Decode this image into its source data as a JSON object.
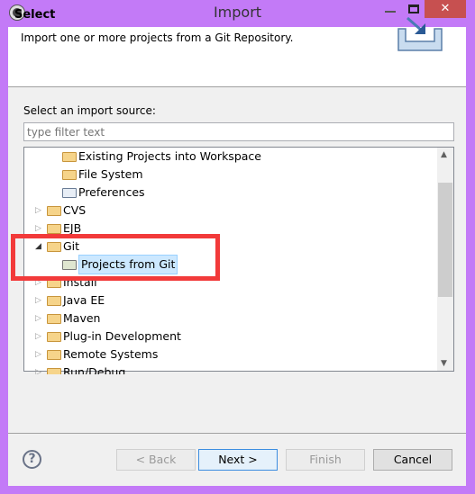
{
  "window": {
    "title": "Import",
    "close_glyph": "✕"
  },
  "header": {
    "title": "Select",
    "description": "Import one or more projects from a Git Repository."
  },
  "source_label": "Select an import source:",
  "filter": {
    "placeholder": "type filter text",
    "value": ""
  },
  "tree": [
    {
      "label": "Existing Projects into Workspace",
      "level": 1,
      "icon": "project-folder-icon"
    },
    {
      "label": "File System",
      "level": 1,
      "icon": "folder-icon"
    },
    {
      "label": "Preferences",
      "level": 1,
      "icon": "preferences-icon"
    },
    {
      "label": "CVS",
      "level": 0,
      "expanded": false
    },
    {
      "label": "EJB",
      "level": 0,
      "expanded": false
    },
    {
      "label": "Git",
      "level": 0,
      "expanded": true
    },
    {
      "label": "Projects from Git",
      "level": 1,
      "icon": "git-icon",
      "selected": true
    },
    {
      "label": "Install",
      "level": 0,
      "expanded": false
    },
    {
      "label": "Java EE",
      "level": 0,
      "expanded": false
    },
    {
      "label": "Maven",
      "level": 0,
      "expanded": false
    },
    {
      "label": "Plug-in Development",
      "level": 0,
      "expanded": false
    },
    {
      "label": "Remote Systems",
      "level": 0,
      "expanded": false
    },
    {
      "label": "Run/Debug",
      "level": 0,
      "expanded": false
    }
  ],
  "buttons": {
    "back": "< Back",
    "next": "Next >",
    "finish": "Finish",
    "cancel": "Cancel",
    "help": "?"
  },
  "colors": {
    "border": "#c37af7",
    "highlight": "#f23a3a",
    "selection": "#cce8ff"
  }
}
